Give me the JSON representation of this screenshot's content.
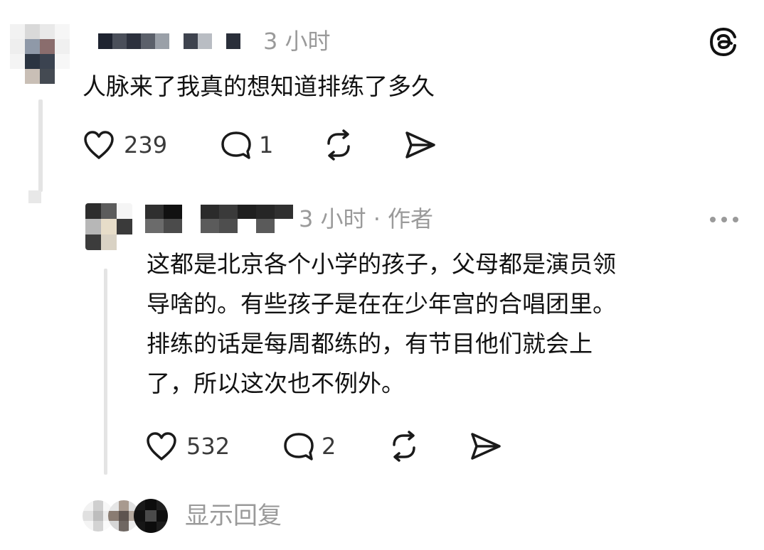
{
  "top_comment": {
    "time": "3 小时",
    "text": "人脉来了我真的想知道排练了多久",
    "likes": "239",
    "replies": "1"
  },
  "reply_comment": {
    "meta": "3 小时 · 作者",
    "text_lines": [
      "这都是北京各个小学的孩子，父母都是演员领",
      "导啥的。有些孩子是在在少年宫的合唱团里。",
      "排练的话是每周都练的，有节目他们就会上",
      "了，所以这次也不例外。"
    ],
    "likes": "532",
    "replies": "2"
  },
  "footer": {
    "show_replies": "显示回复"
  },
  "icons": {
    "brand": "threads-logo-icon",
    "like": "heart-icon",
    "reply": "comment-bubble-icon",
    "repost": "repost-icon",
    "share": "send-icon",
    "more": "more-options-icon"
  },
  "colors": {
    "text": "#121212",
    "muted": "#9a9a9a",
    "icon": "#1a1a1a",
    "thread_line": "#e4e4e4"
  }
}
